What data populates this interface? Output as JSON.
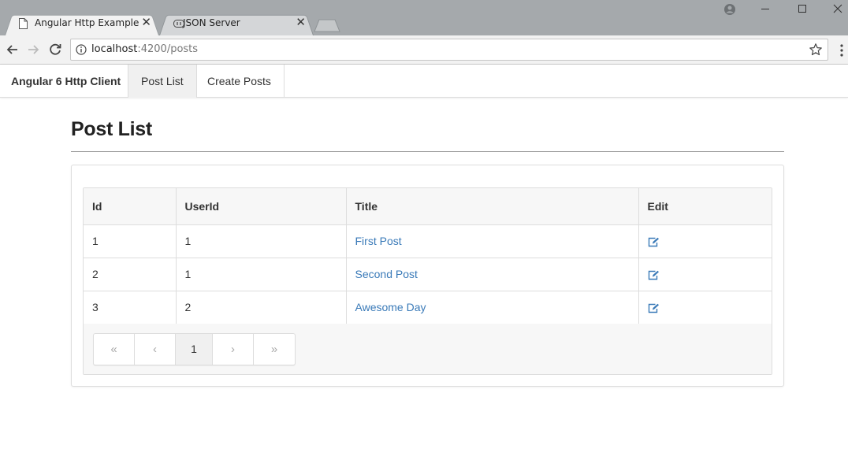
{
  "browser": {
    "tabs": [
      {
        "title": "Angular Http Example",
        "active": true,
        "icon": "page-icon"
      },
      {
        "title": "JSON Server",
        "active": false,
        "icon": "json-server-icon"
      }
    ],
    "url_host": "localhost",
    "url_path": ":4200/posts"
  },
  "navbar": {
    "brand": "Angular 6 Http Client",
    "links": [
      "Post List",
      "Create Posts"
    ]
  },
  "page": {
    "title": "Post List"
  },
  "table": {
    "headers": [
      "Id",
      "UserId",
      "Title",
      "Edit"
    ],
    "rows": [
      {
        "id": "1",
        "userId": "1",
        "title": "First Post"
      },
      {
        "id": "2",
        "userId": "1",
        "title": "Second Post"
      },
      {
        "id": "3",
        "userId": "2",
        "title": "Awesome Day"
      }
    ]
  },
  "pagination": {
    "first": "«",
    "prev": "‹",
    "current": "1",
    "next": "›",
    "last": "»"
  },
  "colors": {
    "link": "#3a7ab8",
    "tabstrip": "#a5a9ac"
  }
}
